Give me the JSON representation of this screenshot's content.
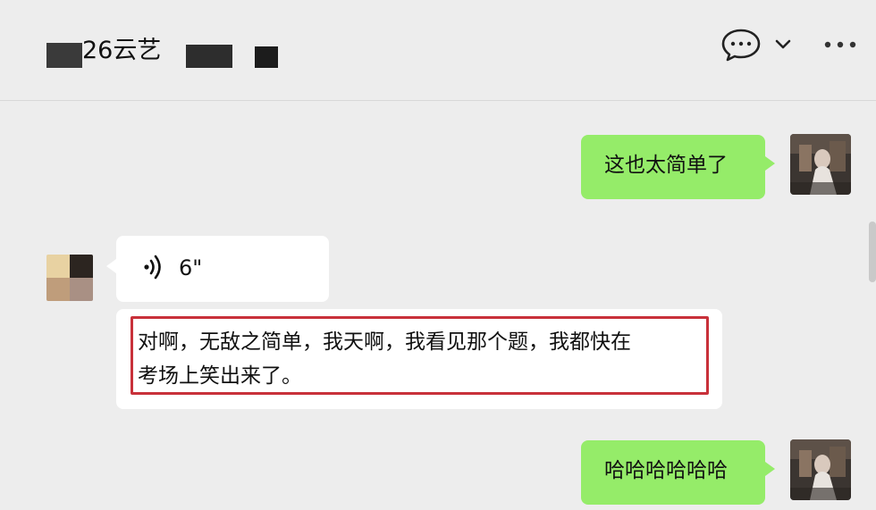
{
  "header": {
    "title": "26云艺",
    "chat_icon": "chat-bubble-icon",
    "dropdown_icon": "chevron-down-icon",
    "more_icon": "more-dots-icon"
  },
  "messages": [
    {
      "side": "right",
      "type": "text",
      "text": "这也太简单了"
    },
    {
      "side": "left",
      "type": "voice",
      "duration": "6\""
    },
    {
      "side": "left",
      "type": "text",
      "lines": [
        "对啊，无敌之简单，我天啊，我看见那个题，我都快在",
        "考场上笑出来了。"
      ],
      "highlighted": true
    },
    {
      "side": "right",
      "type": "text",
      "text": "哈哈哈哈哈哈"
    }
  ],
  "colors": {
    "background": "#ededed",
    "self_bubble": "#95ec69",
    "other_bubble": "#ffffff",
    "highlight_border": "#c8313a"
  }
}
